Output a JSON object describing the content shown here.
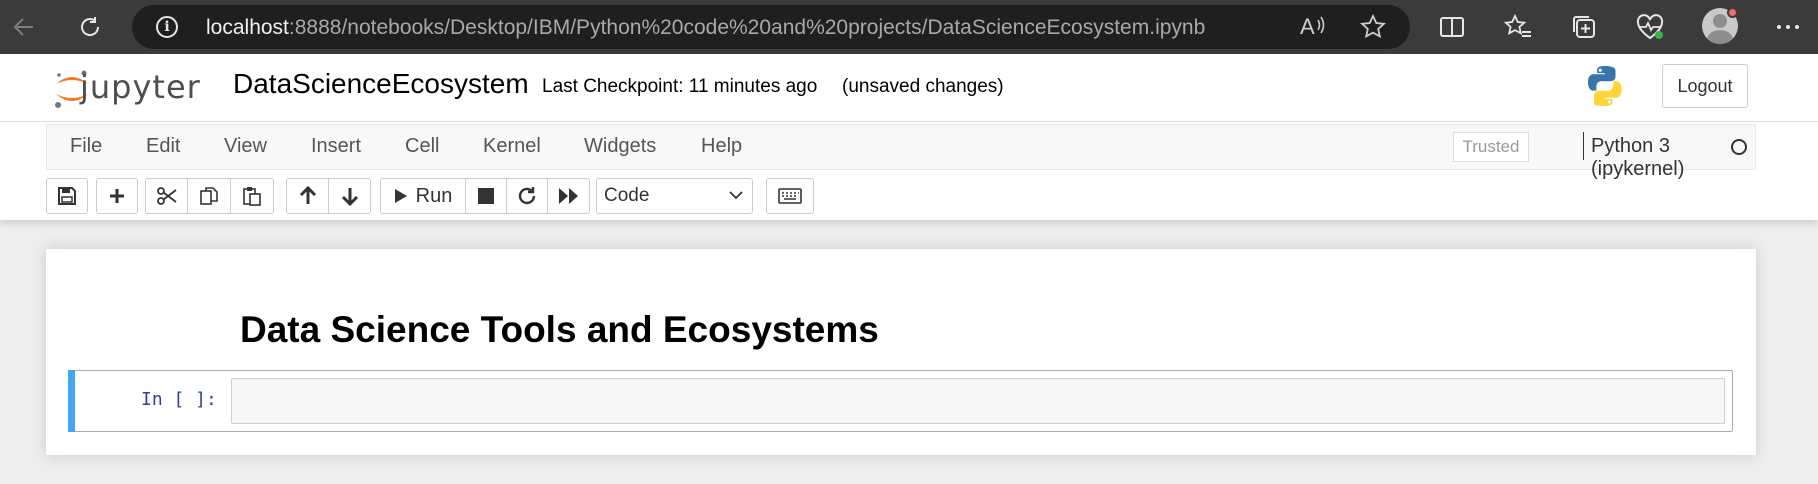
{
  "browser": {
    "url_host": "localhost",
    "url_rest": ":8888/notebooks/Desktop/IBM/Python%20code%20and%20projects/DataScienceEcosystem.ipynb"
  },
  "header": {
    "logo_text": "jupyter",
    "notebook_name": "DataScienceEcosystem",
    "checkpoint": "Last Checkpoint: 11 minutes ago",
    "unsaved": "(unsaved changes)",
    "logout_label": "Logout"
  },
  "menu": {
    "items": [
      "File",
      "Edit",
      "View",
      "Insert",
      "Cell",
      "Kernel",
      "Widgets",
      "Help"
    ],
    "trusted": "Trusted",
    "kernel_name": "Python 3 (ipykernel)"
  },
  "toolbar": {
    "run_label": "Run",
    "cell_type": "Code"
  },
  "notebook": {
    "heading": "Data Science Tools and Ecosystems",
    "prompt": "In [ ]:"
  },
  "colors": {
    "cell_selected_bar": "#42a5f5",
    "prompt": "#303f9f",
    "jupyter_orange": "#f37726"
  }
}
